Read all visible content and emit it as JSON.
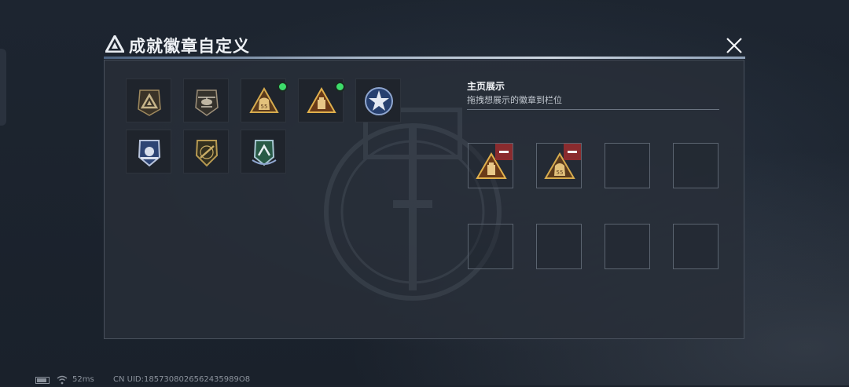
{
  "window": {
    "title": "成就徽章自定义",
    "title_icon": "triangle-emblem-icon",
    "close_icon": "close-icon"
  },
  "badges": [
    {
      "name": "triangle-emblem-badge",
      "has_new": false
    },
    {
      "name": "helicopter-badge",
      "has_new": false
    },
    {
      "name": "money-bag-55-badge",
      "has_new": true
    },
    {
      "name": "briefcase-triangle-badge",
      "has_new": true
    },
    {
      "name": "blue-star-badge",
      "has_new": false
    },
    {
      "name": "blue-shield-badge",
      "has_new": false
    },
    {
      "name": "gold-shield-rifle-badge",
      "has_new": false
    },
    {
      "name": "green-crest-badge",
      "has_new": false
    }
  ],
  "showcase": {
    "title": "主页展示",
    "subtitle": "拖拽想展示的徽章到栏位",
    "slots": [
      {
        "badge": "briefcase-triangle-badge",
        "removable": true
      },
      {
        "badge": "money-bag-55-badge",
        "removable": true
      },
      {
        "badge": "",
        "removable": false
      },
      {
        "badge": "",
        "removable": false
      },
      {
        "badge": "",
        "removable": false
      },
      {
        "badge": "",
        "removable": false
      },
      {
        "badge": "",
        "removable": false
      },
      {
        "badge": "",
        "removable": false
      }
    ]
  },
  "status": {
    "battery_icon": "battery-icon",
    "wifi_icon": "wifi-icon",
    "ping": "52ms",
    "uid": "CN UID:1857308026562435989O8"
  },
  "colors": {
    "new_dot": "#3ddc6a",
    "remove_button": "#8a2b2e",
    "gold": "#c9a24a"
  }
}
